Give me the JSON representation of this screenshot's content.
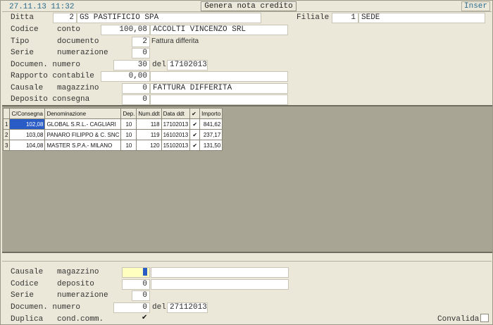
{
  "header": {
    "datetime": "27.11.13 11:32",
    "action_button": "Genera nota credito",
    "mode": "Inser"
  },
  "form": {
    "ditta": {
      "label": "Ditta",
      "code": "2",
      "name": "GS PASTIFICIO SPA"
    },
    "filiale": {
      "label": "Filiale",
      "code": "1",
      "name": "SEDE"
    },
    "codice_conto": {
      "label": "Codice    conto",
      "code": "100,08",
      "name": "ACCOLTI VINCENZO SRL"
    },
    "tipo_documento": {
      "label": "Tipo      documento",
      "code": "2",
      "desc": "Fattura differita"
    },
    "serie_numerazione": {
      "label": "Serie     numerazione",
      "value": "0"
    },
    "documen_numero": {
      "label": "Documen. numero",
      "value": "30",
      "del_label": "del",
      "date": "17102013"
    },
    "rapporto_contabile": {
      "label": "Rapporto contabile",
      "value": "0,00",
      "desc": ""
    },
    "causale_magazzino": {
      "label": "Causale   magazzino",
      "code": "0",
      "desc": "FATTURA DIFFERITA"
    },
    "deposito_consegna": {
      "label": "Deposito consegna",
      "code": "0",
      "desc": ""
    }
  },
  "grid": {
    "columns": [
      "C/Consegna",
      "Denominazione",
      "Dep.",
      "Num.ddt",
      "Data ddt",
      "✔",
      "Importo"
    ],
    "rows": [
      {
        "num": "1",
        "consegna": "102,08",
        "denominazione": "GLOBAL S.R.L.- CAGLIARI",
        "dep": "10",
        "num_ddt": "118",
        "data_ddt": "17102013",
        "checked": "✔",
        "importo": "841,62"
      },
      {
        "num": "2",
        "consegna": "103,08",
        "denominazione": "PANARO FILIPPO & C. SNC",
        "dep": "10",
        "num_ddt": "119",
        "data_ddt": "16102013",
        "checked": "✔",
        "importo": "237,17"
      },
      {
        "num": "3",
        "consegna": "104,08",
        "denominazione": "MASTER S.P.A.- MILANO",
        "dep": "10",
        "num_ddt": "120",
        "data_ddt": "15102013",
        "checked": "✔",
        "importo": "131,50"
      }
    ]
  },
  "bottom_form": {
    "causale_magazzino": {
      "label": "Causale   magazzino",
      "code": "0",
      "desc": ""
    },
    "codice_deposito": {
      "label": "Codice    deposito",
      "code": "0",
      "desc": ""
    },
    "serie_numerazione": {
      "label": "Serie     numerazione",
      "value": "0"
    },
    "documen_numero": {
      "label": "Documen. numero",
      "value": "0",
      "del_label": "del",
      "date": "27112013"
    },
    "duplica": {
      "label": "Duplica   cond.comm.",
      "checked": "✔"
    },
    "convalida": {
      "label": "Convalida"
    }
  }
}
